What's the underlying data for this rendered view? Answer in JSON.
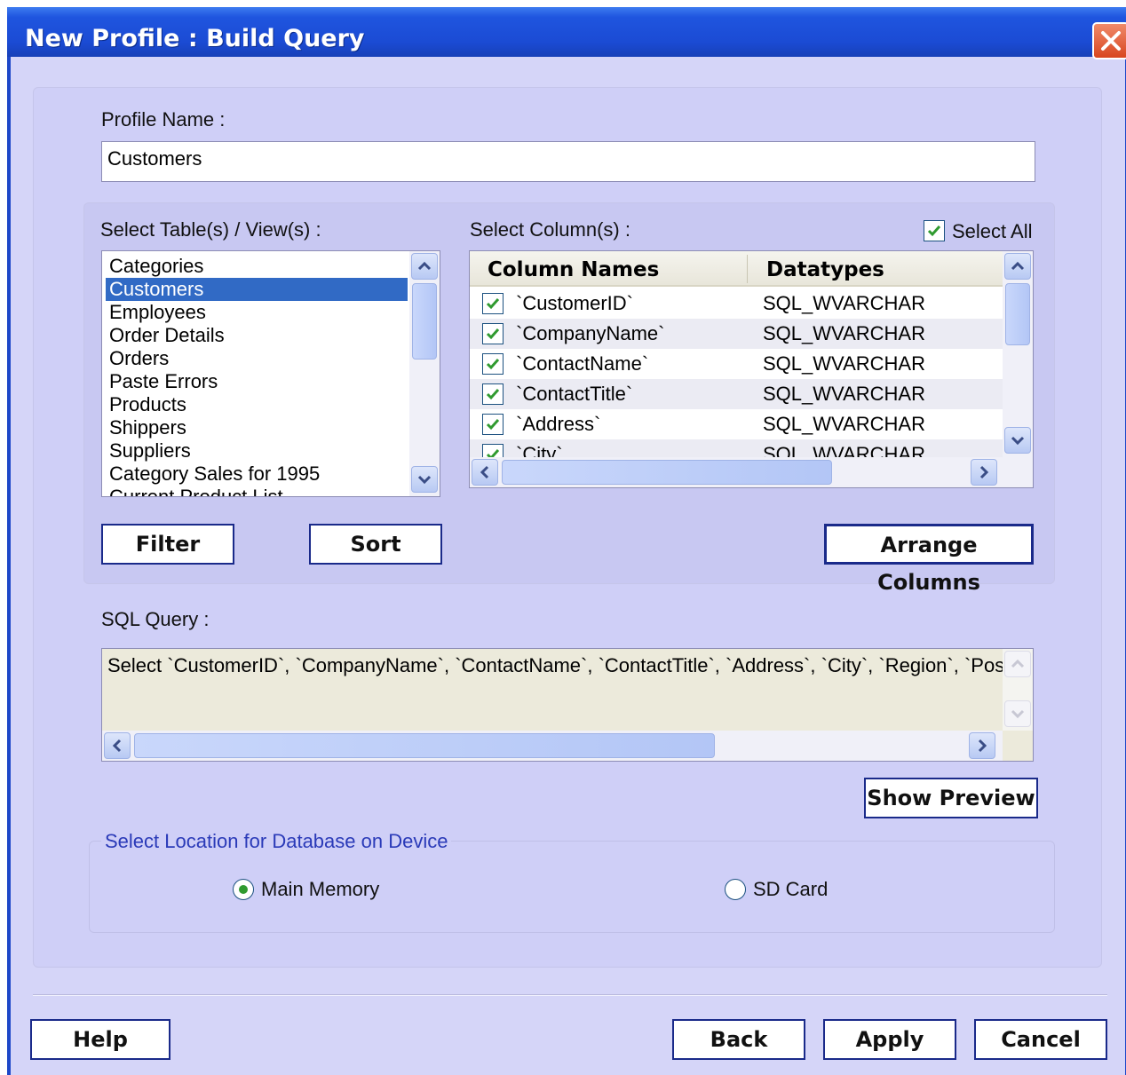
{
  "window": {
    "title": "New Profile : Build Query"
  },
  "profile": {
    "label": "Profile Name :",
    "value": "Customers"
  },
  "tables": {
    "label": "Select Table(s) / View(s) :",
    "items": [
      {
        "label": "Categories",
        "selected": false
      },
      {
        "label": "Customers",
        "selected": true
      },
      {
        "label": "Employees",
        "selected": false
      },
      {
        "label": "Order Details",
        "selected": false
      },
      {
        "label": "Orders",
        "selected": false
      },
      {
        "label": "Paste Errors",
        "selected": false
      },
      {
        "label": "Products",
        "selected": false
      },
      {
        "label": "Shippers",
        "selected": false
      },
      {
        "label": "Suppliers",
        "selected": false
      },
      {
        "label": "Category Sales for 1995",
        "selected": false
      },
      {
        "label": "Current Product List",
        "selected": false
      }
    ]
  },
  "columns": {
    "label": "Select Column(s) :",
    "select_all_label": "Select All",
    "select_all_checked": true,
    "headers": [
      "Column Names",
      "Datatypes"
    ],
    "rows": [
      {
        "name": "`CustomerID`",
        "type": "SQL_WVARCHAR",
        "checked": true
      },
      {
        "name": "`CompanyName`",
        "type": "SQL_WVARCHAR",
        "checked": true
      },
      {
        "name": "`ContactName`",
        "type": "SQL_WVARCHAR",
        "checked": true
      },
      {
        "name": "`ContactTitle`",
        "type": "SQL_WVARCHAR",
        "checked": true
      },
      {
        "name": "`Address`",
        "type": "SQL_WVARCHAR",
        "checked": true
      },
      {
        "name": "`City`",
        "type": "SQL_WVARCHAR",
        "checked": true
      }
    ]
  },
  "buttons": {
    "filter": "Filter",
    "sort": "Sort",
    "arrange": "Arrange Columns",
    "show_preview": "Show Preview",
    "help": "Help",
    "back": "Back",
    "apply": "Apply",
    "cancel": "Cancel"
  },
  "sql": {
    "label": "SQL Query :",
    "text": "Select `CustomerID`, `CompanyName`, `ContactName`, `ContactTitle`, `Address`, `City`, `Region`, `PostalCo"
  },
  "location": {
    "label": "Select Location for Database on Device",
    "options": [
      {
        "label": "Main Memory",
        "selected": true
      },
      {
        "label": "SD Card",
        "selected": false
      }
    ]
  },
  "colors": {
    "titlebar": "#1b4bd4",
    "window_bg": "#d5d5f8",
    "selection": "#316ac5",
    "check_green": "#2f9a2f"
  }
}
